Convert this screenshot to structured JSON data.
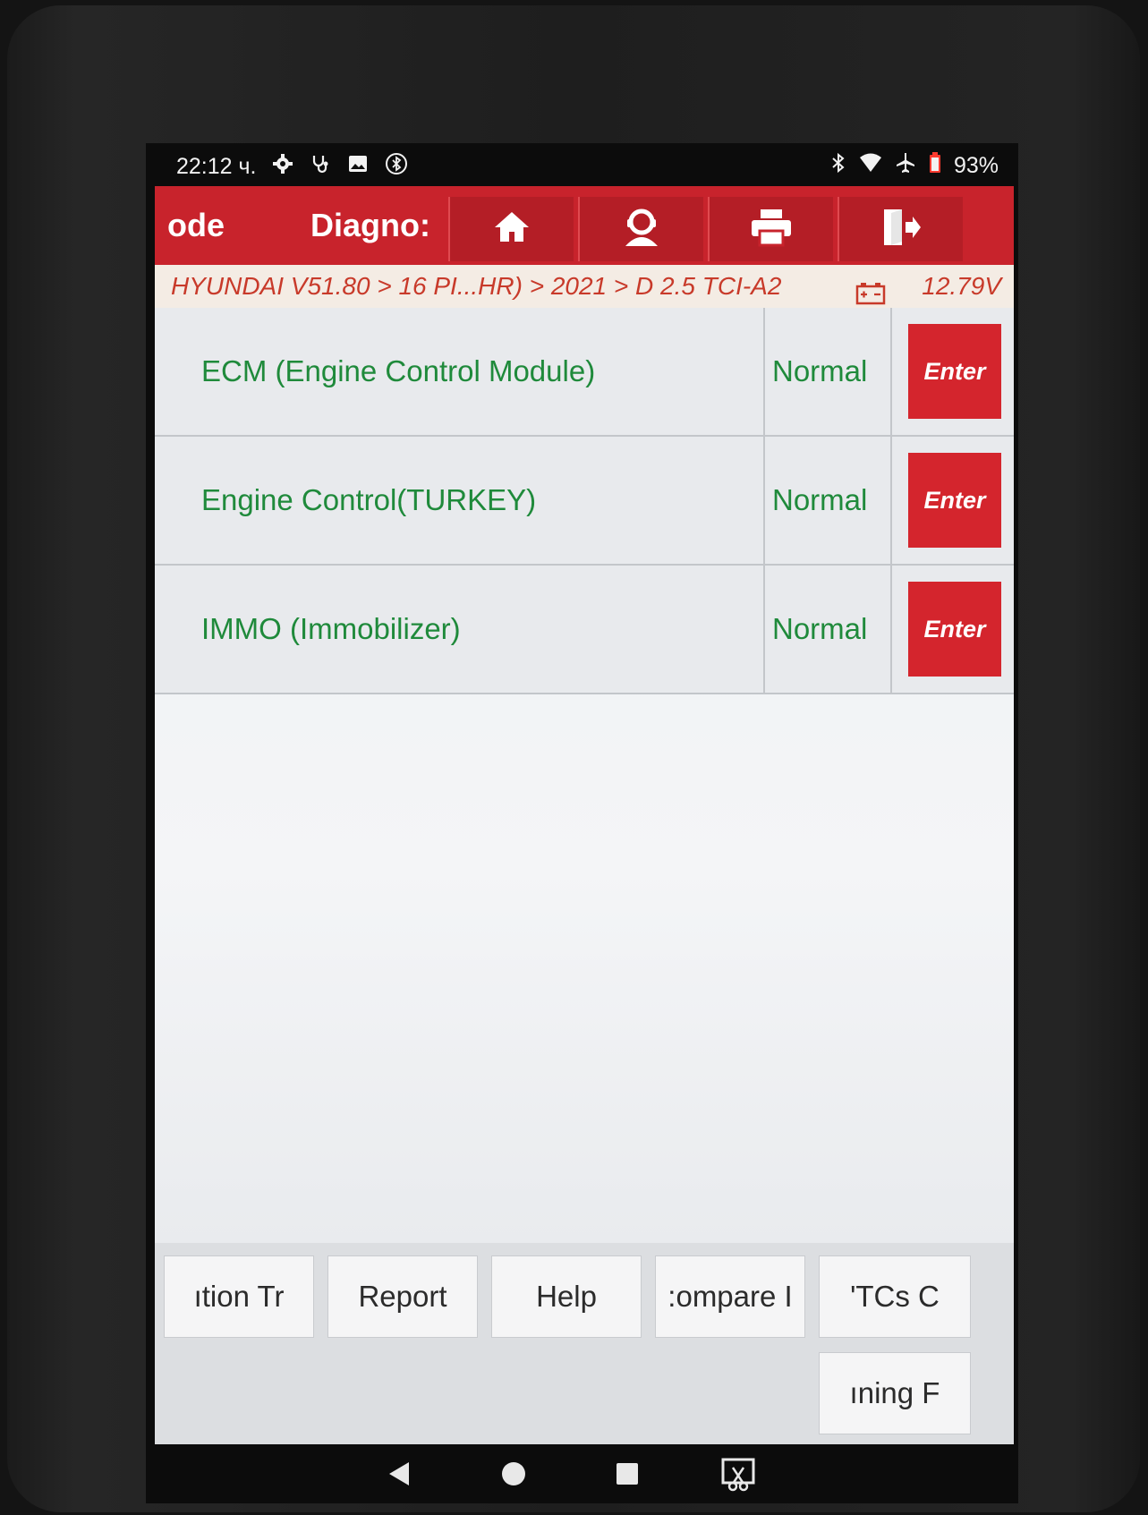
{
  "status_bar": {
    "time": "22:12 ч.",
    "battery": "93%",
    "icons": [
      "gear-icon",
      "stethoscope-icon",
      "image-icon",
      "bluetooth-circle-icon",
      "bluetooth-icon",
      "wifi-icon",
      "airplane-icon",
      "battery-icon"
    ]
  },
  "toolbar": {
    "tab_left": "ode",
    "tab_diag": "Diagno:",
    "buttons": [
      "home-icon",
      "support-icon",
      "print-icon",
      "exit-icon"
    ]
  },
  "breadcrumb": {
    "path": "HYUNDAI V51.80 > 16 PI...HR) > 2021 > D 2.5 TCI-A2",
    "voltage": "12.79V"
  },
  "systems": [
    {
      "name": "ECM (Engine Control Module)",
      "status": "Normal",
      "action": "Enter"
    },
    {
      "name": "Engine Control(TURKEY)",
      "status": "Normal",
      "action": "Enter"
    },
    {
      "name": "IMMO (Immobilizer)",
      "status": "Normal",
      "action": "Enter"
    }
  ],
  "bottom_buttons": [
    "ıtion Tr",
    "Report",
    "Help",
    ":ompare I",
    "'TCs C",
    "ıning F"
  ],
  "colors": {
    "accent": "#c8232c",
    "status_green": "#1f8a3b",
    "breadcrumb_text": "#c83a2a"
  }
}
